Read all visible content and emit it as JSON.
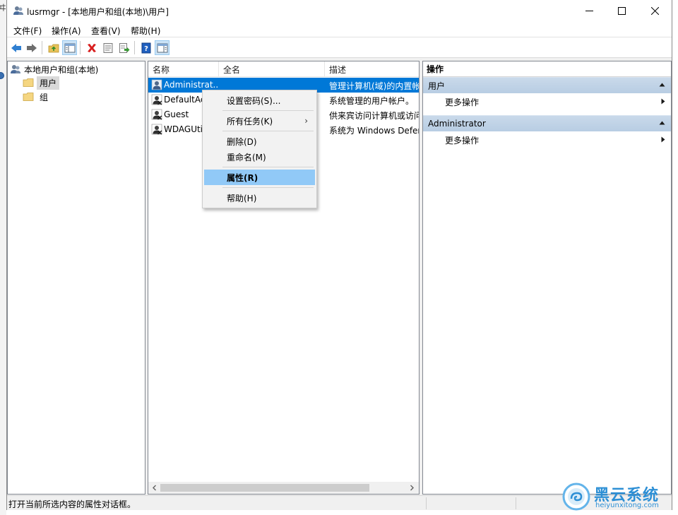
{
  "window": {
    "title": "lusrmgr - [本地用户和组(本地)\\用户]"
  },
  "menubar": {
    "items": [
      "文件(F)",
      "操作(A)",
      "查看(V)",
      "帮助(H)"
    ]
  },
  "tree": {
    "root": "本地用户和组(本地)",
    "children": [
      {
        "label": "用户",
        "selected": true
      },
      {
        "label": "组",
        "selected": false
      }
    ]
  },
  "list": {
    "columns": [
      "名称",
      "全名",
      "描述"
    ],
    "rows": [
      {
        "name": "Administrat...",
        "fullname": "",
        "description": "管理计算机(域)的内置帐",
        "selected": true
      },
      {
        "name": "DefaultAc",
        "fullname": "",
        "description": "系统管理的用户帐户。",
        "selected": false
      },
      {
        "name": "Guest",
        "fullname": "",
        "description": "供来宾访问计算机或访问",
        "selected": false
      },
      {
        "name": "WDAGUti",
        "fullname": "",
        "description": "系统为 Windows Defen",
        "selected": false
      }
    ]
  },
  "context_menu": {
    "set_password": "设置密码(S)...",
    "all_tasks": "所有任务(K)",
    "delete": "删除(D)",
    "rename": "重命名(M)",
    "properties": "属性(R)",
    "help": "帮助(H)"
  },
  "actions": {
    "header": "操作",
    "groups": [
      {
        "title": "用户",
        "item": "更多操作"
      },
      {
        "title": "Administrator",
        "item": "更多操作"
      }
    ]
  },
  "statusbar": {
    "text": "打开当前所选内容的属性对话框。"
  },
  "watermark": {
    "name": "黑云系统",
    "url": "heiyunxitong.com"
  },
  "desktop_edge_glyph": "ヰ",
  "colors": {
    "selection": "#0078d7",
    "menu_highlight": "#91c9f7",
    "action_group": "#c4d6ea",
    "watermark": "#2d8fd5"
  },
  "icons": {
    "back": "back-arrow-icon",
    "forward": "forward-arrow-icon",
    "up": "up-folder-icon",
    "show_tree": "show-tree-icon",
    "delete": "delete-x-icon",
    "properties": "properties-icon",
    "export": "export-list-icon",
    "help": "help-icon",
    "action_pane": "action-pane-icon"
  }
}
